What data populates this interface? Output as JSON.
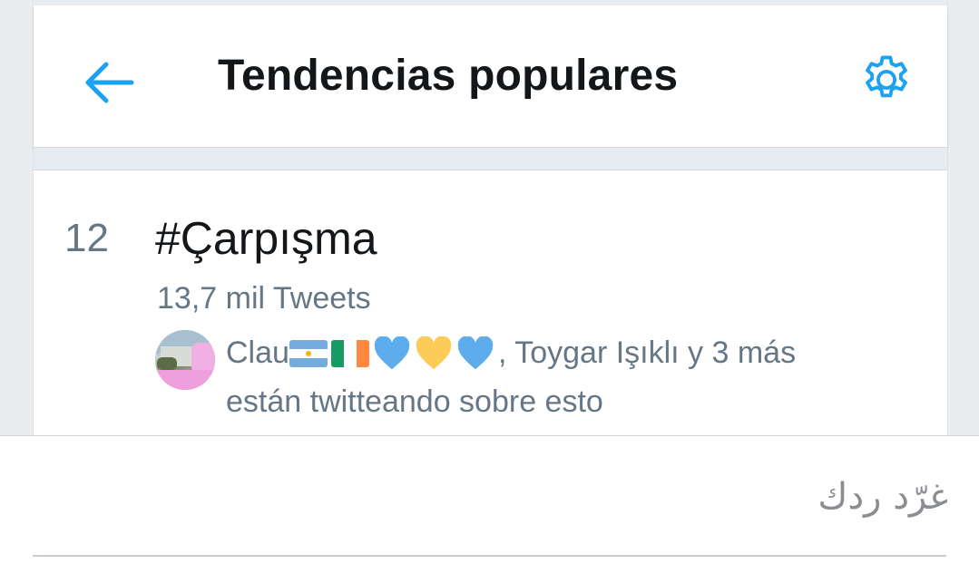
{
  "header": {
    "title": "Tendencias populares",
    "back_icon": "arrow-left-icon",
    "settings_icon": "gear-icon",
    "accent_color": "#1da1f2"
  },
  "trend": {
    "rank": "12",
    "name": "#Çarpışma",
    "tweet_count": "13,7 mil Tweets",
    "social_user": "Clau",
    "social_emoji": [
      "argentina-flag",
      "ireland-flag",
      "blue-heart",
      "yellow-heart",
      "blue-heart"
    ],
    "social_rest": ", Toygar Işıklı y 3 más",
    "social_line2": "están twitteando sobre esto"
  },
  "reply": {
    "placeholder": "غرّد ردك"
  }
}
